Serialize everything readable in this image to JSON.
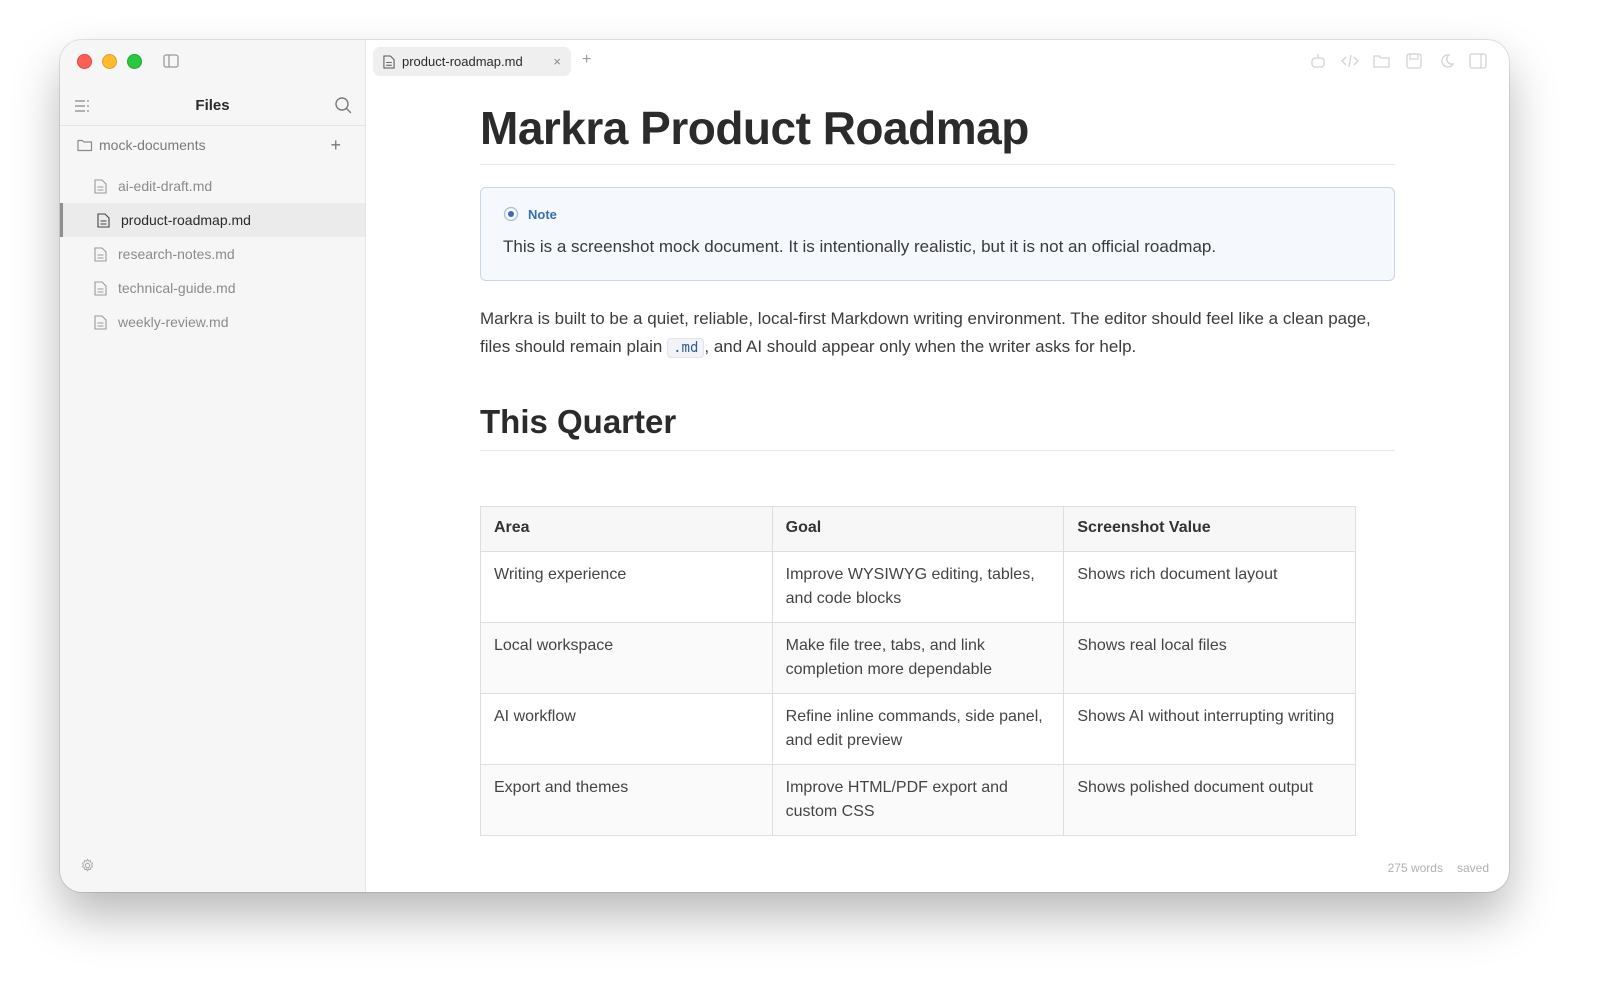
{
  "sidebar": {
    "title": "Files",
    "folder": {
      "name": "mock-documents",
      "add_label": "+"
    },
    "files": [
      {
        "name": "ai-edit-draft.md",
        "active": false
      },
      {
        "name": "product-roadmap.md",
        "active": true
      },
      {
        "name": "research-notes.md",
        "active": false
      },
      {
        "name": "technical-guide.md",
        "active": false
      },
      {
        "name": "weekly-review.md",
        "active": false
      }
    ]
  },
  "tabs": {
    "active": {
      "label": "product-roadmap.md",
      "close": "×"
    },
    "new_tab": "+"
  },
  "document": {
    "title": "Markra Product Roadmap",
    "note": {
      "label": "Note",
      "text": "This is a screenshot mock document. It is intentionally realistic, but it is not an official roadmap."
    },
    "intro": {
      "before": "Markra is built to be a quiet, reliable, local-first Markdown writing environment. The editor should feel like a clean page, files should remain plain ",
      "code": ".md",
      "after": ", and AI should appear only when the writer asks for help."
    },
    "section_title": "This Quarter",
    "table": {
      "headers": [
        "Area",
        "Goal",
        "Screenshot Value"
      ],
      "rows": [
        [
          "Writing experience",
          "Improve WYSIWYG editing, tables, and code blocks",
          "Shows rich document layout"
        ],
        [
          "Local workspace",
          "Make file tree, tabs, and link completion more dependable",
          "Shows real local files"
        ],
        [
          "AI workflow",
          "Refine inline commands, side panel, and edit preview",
          "Shows AI without interrupting writing"
        ],
        [
          "Export and themes",
          "Improve HTML/PDF export and custom CSS",
          "Shows polished document output"
        ]
      ]
    }
  },
  "status": {
    "words": "275 words",
    "state": "saved"
  },
  "colors": {
    "accent": "#3a6db0",
    "close": "#ff5f57",
    "minimize": "#febc2e",
    "maximize": "#28c840"
  }
}
